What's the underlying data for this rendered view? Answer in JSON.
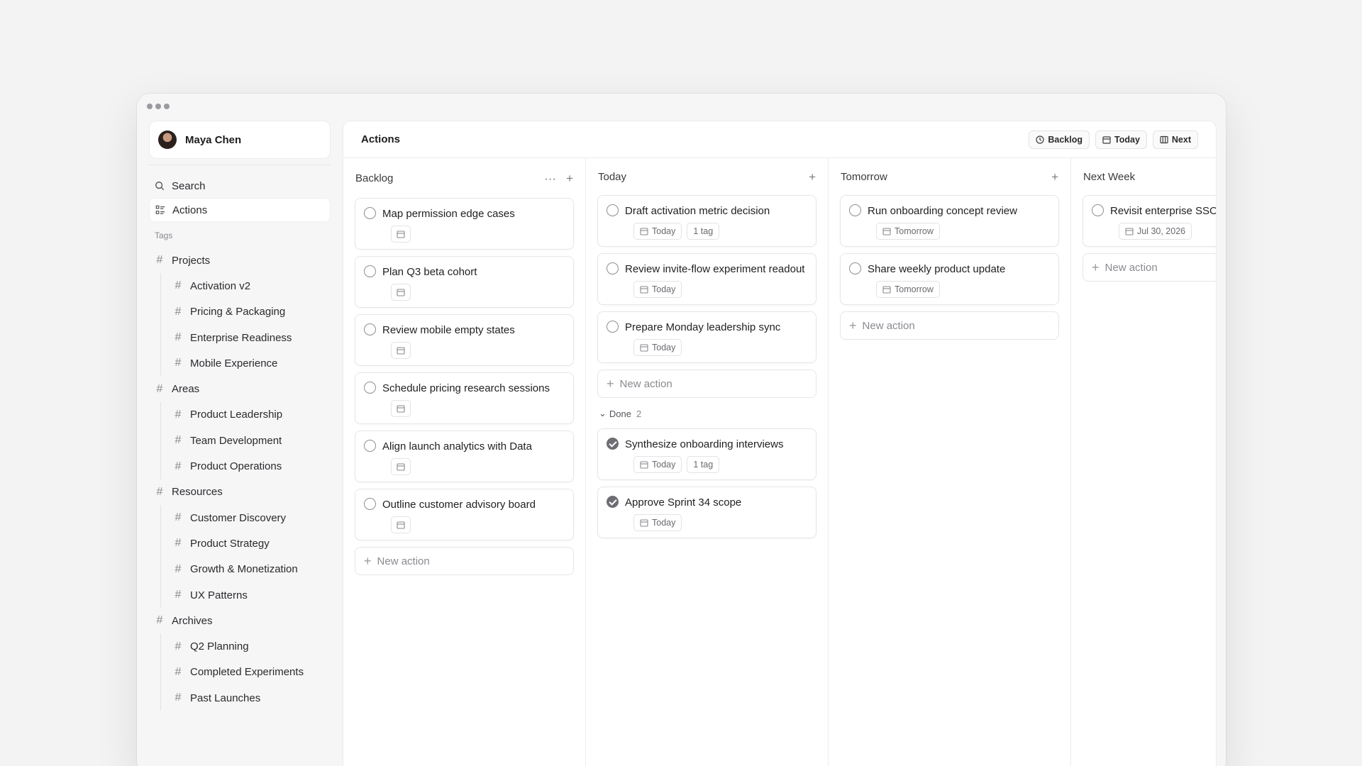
{
  "profile": {
    "name": "Maya Chen"
  },
  "nav": {
    "search": "Search",
    "actions": "Actions"
  },
  "tags": {
    "label": "Tags",
    "groups": [
      {
        "name": "Projects",
        "children": [
          "Activation v2",
          "Pricing & Packaging",
          "Enterprise Readiness",
          "Mobile Experience"
        ]
      },
      {
        "name": "Areas",
        "children": [
          "Product Leadership",
          "Team Development",
          "Product Operations"
        ]
      },
      {
        "name": "Resources",
        "children": [
          "Customer Discovery",
          "Product Strategy",
          "Growth & Monetization",
          "UX Patterns"
        ]
      },
      {
        "name": "Archives",
        "children": [
          "Q2 Planning",
          "Completed Experiments",
          "Past Launches"
        ]
      }
    ]
  },
  "main": {
    "title": "Actions",
    "views": {
      "backlog": "Backlog",
      "today": "Today",
      "next": "Next"
    }
  },
  "columns": {
    "backlog": {
      "title": "Backlog",
      "cards": [
        "Map permission edge cases",
        "Plan Q3 beta cohort",
        "Review mobile empty states",
        "Schedule pricing research sessions",
        "Align launch analytics with Data",
        "Outline customer advisory board"
      ],
      "new_action": "New action"
    },
    "today": {
      "title": "Today",
      "cards": [
        {
          "title": "Draft activation metric decision",
          "date": "Today",
          "tag": "1 tag"
        },
        {
          "title": "Review invite-flow experiment readout",
          "date": "Today"
        },
        {
          "title": "Prepare Monday leadership sync",
          "date": "Today"
        }
      ],
      "new_action": "New action",
      "done": {
        "label": "Done",
        "count": "2",
        "cards": [
          {
            "title": "Synthesize onboarding interviews",
            "date": "Today",
            "tag": "1 tag"
          },
          {
            "title": "Approve Sprint 34 scope",
            "date": "Today"
          }
        ]
      }
    },
    "tomorrow": {
      "title": "Tomorrow",
      "cards": [
        {
          "title": "Run onboarding concept review",
          "date": "Tomorrow"
        },
        {
          "title": "Share weekly product update",
          "date": "Tomorrow"
        }
      ],
      "new_action": "New action"
    },
    "next_week": {
      "title": "Next Week",
      "cards": [
        {
          "title": "Revisit enterprise SSO",
          "date": "Jul 30, 2026"
        }
      ],
      "new_action": "New action"
    }
  }
}
